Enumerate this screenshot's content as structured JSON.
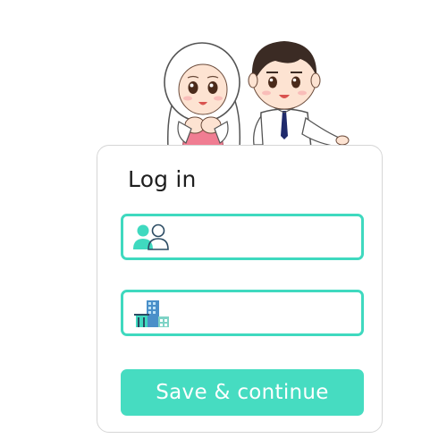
{
  "login_card": {
    "title": "Log in",
    "username_field": {
      "icon": "users-icon",
      "value": "",
      "placeholder": ""
    },
    "company_field": {
      "icon": "building-icon",
      "value": "",
      "placeholder": ""
    },
    "save_button_label": "Save & continue"
  },
  "mascots": {
    "illustration": "mascot-couple-illustration"
  },
  "colors": {
    "accent": "#3fd9bf",
    "button_bg": "#46dcc1",
    "button_text": "#ffffff",
    "card_border": "#d6d6d6",
    "title_text": "#1f1f1f"
  }
}
